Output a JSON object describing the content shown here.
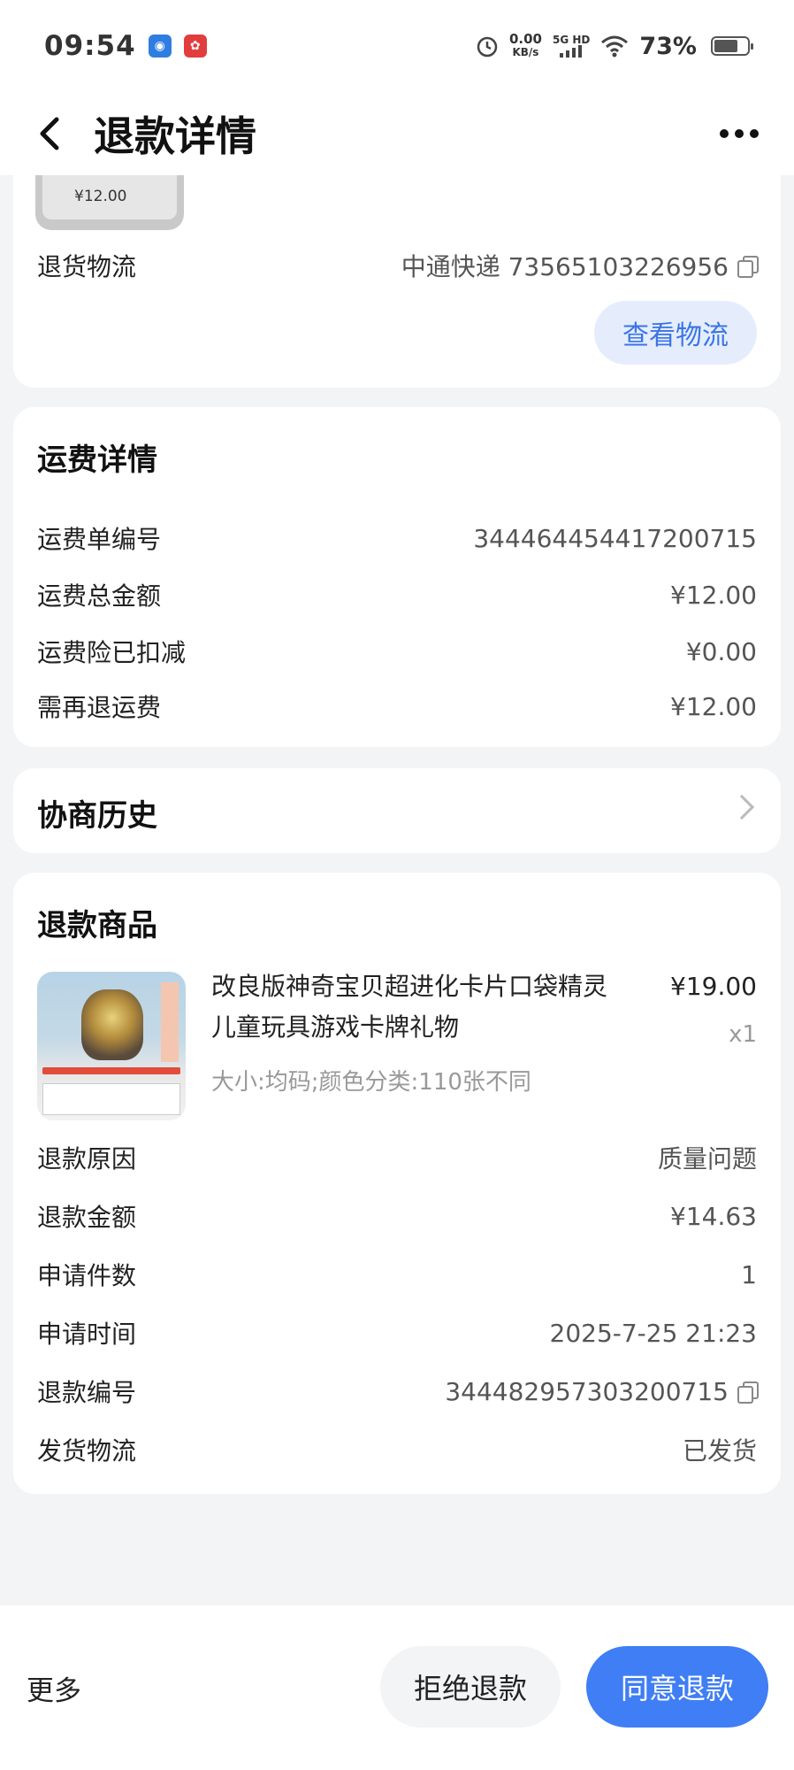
{
  "status_bar": {
    "time": "09:54",
    "net_speed_value": "0.00",
    "net_speed_unit": "KB/s",
    "net_type": "5G HD",
    "battery": "73%",
    "battery_level": 0.73
  },
  "nav": {
    "title": "退款详情"
  },
  "return_shipping": {
    "thumb_price": "¥12.00",
    "label": "退货物流",
    "value": "中通快递 73565103226956",
    "button": "查看物流"
  },
  "shipping_fee": {
    "title": "运费详情",
    "rows": [
      {
        "label": "运费单编号",
        "value": "344464454417200715"
      },
      {
        "label": "运费总金额",
        "value": "¥12.00"
      },
      {
        "label": "运费险已扣减",
        "value": "¥0.00"
      },
      {
        "label": "需再退运费",
        "value": "¥12.00"
      }
    ]
  },
  "negotiation": {
    "title": "协商历史"
  },
  "refund_goods": {
    "title": "退款商品",
    "product_title": "改良版神奇宝贝超进化卡片口袋精灵儿童玩具游戏卡牌礼物",
    "price": "¥19.00",
    "quantity": "x1",
    "sku": "大小:均码;颜色分类:110张不同",
    "rows": [
      {
        "label": "退款原因",
        "value": "质量问题"
      },
      {
        "label": "退款金额",
        "value": "¥14.63"
      },
      {
        "label": "申请件数",
        "value": "1"
      },
      {
        "label": "申请时间",
        "value": "2025-7-25 21:23"
      },
      {
        "label": "退款编号",
        "value": "344482957303200715"
      },
      {
        "label": "发货物流",
        "value": "已发货"
      }
    ]
  },
  "bottom": {
    "more": "更多",
    "reject": "拒绝退款",
    "agree": "同意退款"
  },
  "colors": {
    "accent": "#3f7ef4",
    "accent_light": "#e5edfd",
    "background": "#f3f4f6"
  }
}
